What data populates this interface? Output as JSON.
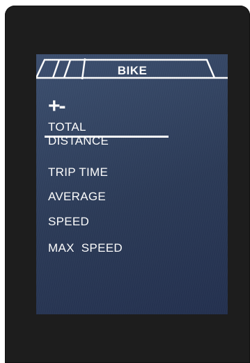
{
  "header": {
    "tab_label": "BIKE"
  },
  "controls": {
    "adjust_symbol": "+-"
  },
  "menu": {
    "items": [
      {
        "label": "TOTAL\nDISTANCE"
      },
      {
        "label": "TRIP TIME"
      },
      {
        "label": "AVERAGE"
      },
      {
        "label": "SPEED"
      },
      {
        "label": "MAX  SPEED"
      }
    ]
  },
  "colors": {
    "device_bezel": "#1d1d1d",
    "screen_background": "#2f3e5c",
    "foreground": "#ffffff"
  }
}
